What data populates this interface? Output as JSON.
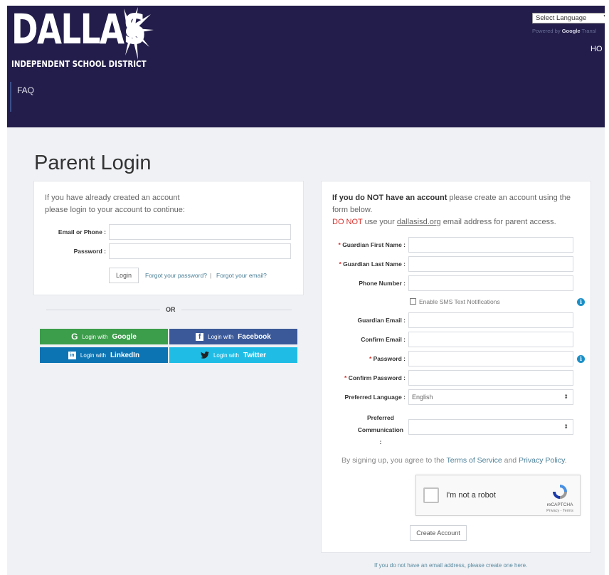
{
  "header": {
    "logo_word": "DALLAS",
    "logo_sub": "INDEPENDENT SCHOOL DISTRICT",
    "nav_faq": "FAQ",
    "nav_home_partial": "HO",
    "language_select": "Select Language",
    "powered_prefix": "Powered by",
    "powered_brand": "Google",
    "powered_suffix": "Transl"
  },
  "page_title": "Parent Login",
  "login": {
    "intro_line1": "If you have already created an account",
    "intro_line2": "please login to your account to continue:",
    "email_label": "Email or Phone :",
    "email_value": "",
    "password_label": "Password :",
    "password_value": "",
    "login_button": "Login",
    "forgot_password": "Forgot your password?",
    "separator": "|",
    "forgot_email": "Forgot your email?",
    "or_text": "OR"
  },
  "social": {
    "google": {
      "prefix": "Login with",
      "name": "Google",
      "color": "#3c9d4a"
    },
    "facebook": {
      "prefix": "Login with",
      "name": "Facebook",
      "color": "#3b5998"
    },
    "linkedin": {
      "prefix": "Login with",
      "name": "LinkedIn",
      "color": "#0c74b3"
    },
    "twitter": {
      "prefix": "Login with",
      "name": "Twitter",
      "color": "#1fbde6"
    }
  },
  "register": {
    "intro_part1": "If you do NOT have an account",
    "intro_part2": " please create an account using the",
    "intro_line2": "form below.",
    "warning_bold": "DO NOT",
    "warning_rest1": " use your ",
    "warning_domain": "dallasisd.org",
    "warning_rest2": " email address for parent access.",
    "required_mark": "*",
    "first_name_label": "Guardian First Name :",
    "first_name_value": "",
    "last_name_label": "Guardian Last Name :",
    "last_name_value": "",
    "phone_label": "Phone Number :",
    "phone_value": "",
    "sms_label": "Enable SMS Text Notifications",
    "sms_checked": false,
    "email_label": "Guardian Email :",
    "email_value": "",
    "confirm_email_label": "Confirm Email :",
    "confirm_email_value": "",
    "password_label": "Password :",
    "password_value": "",
    "confirm_password_label": "Confirm Password :",
    "confirm_password_value": "",
    "language_label": "Preferred Language :",
    "language_value": "English",
    "comm_label_line1": "Preferred",
    "comm_label_line2": "Communication",
    "comm_label_line3": ":",
    "comm_value": "",
    "terms_prefix": "By signing up, you agree to the ",
    "terms_link": "Terms of Service",
    "terms_and": " and ",
    "privacy_link": "Privacy Policy",
    "terms_suffix": ".",
    "create_button": "Create Account"
  },
  "captcha": {
    "label": "I'm not a robot",
    "brand": "reCAPTCHA",
    "terms": "Privacy - Terms"
  },
  "footer_note": "If you do not have an email address, please create one here.",
  "colors": {
    "header_bg": "#221d4a",
    "page_bg": "#eff1f5",
    "link": "#4a7f97",
    "required": "#d9302b",
    "info": "#1a8fc7"
  }
}
